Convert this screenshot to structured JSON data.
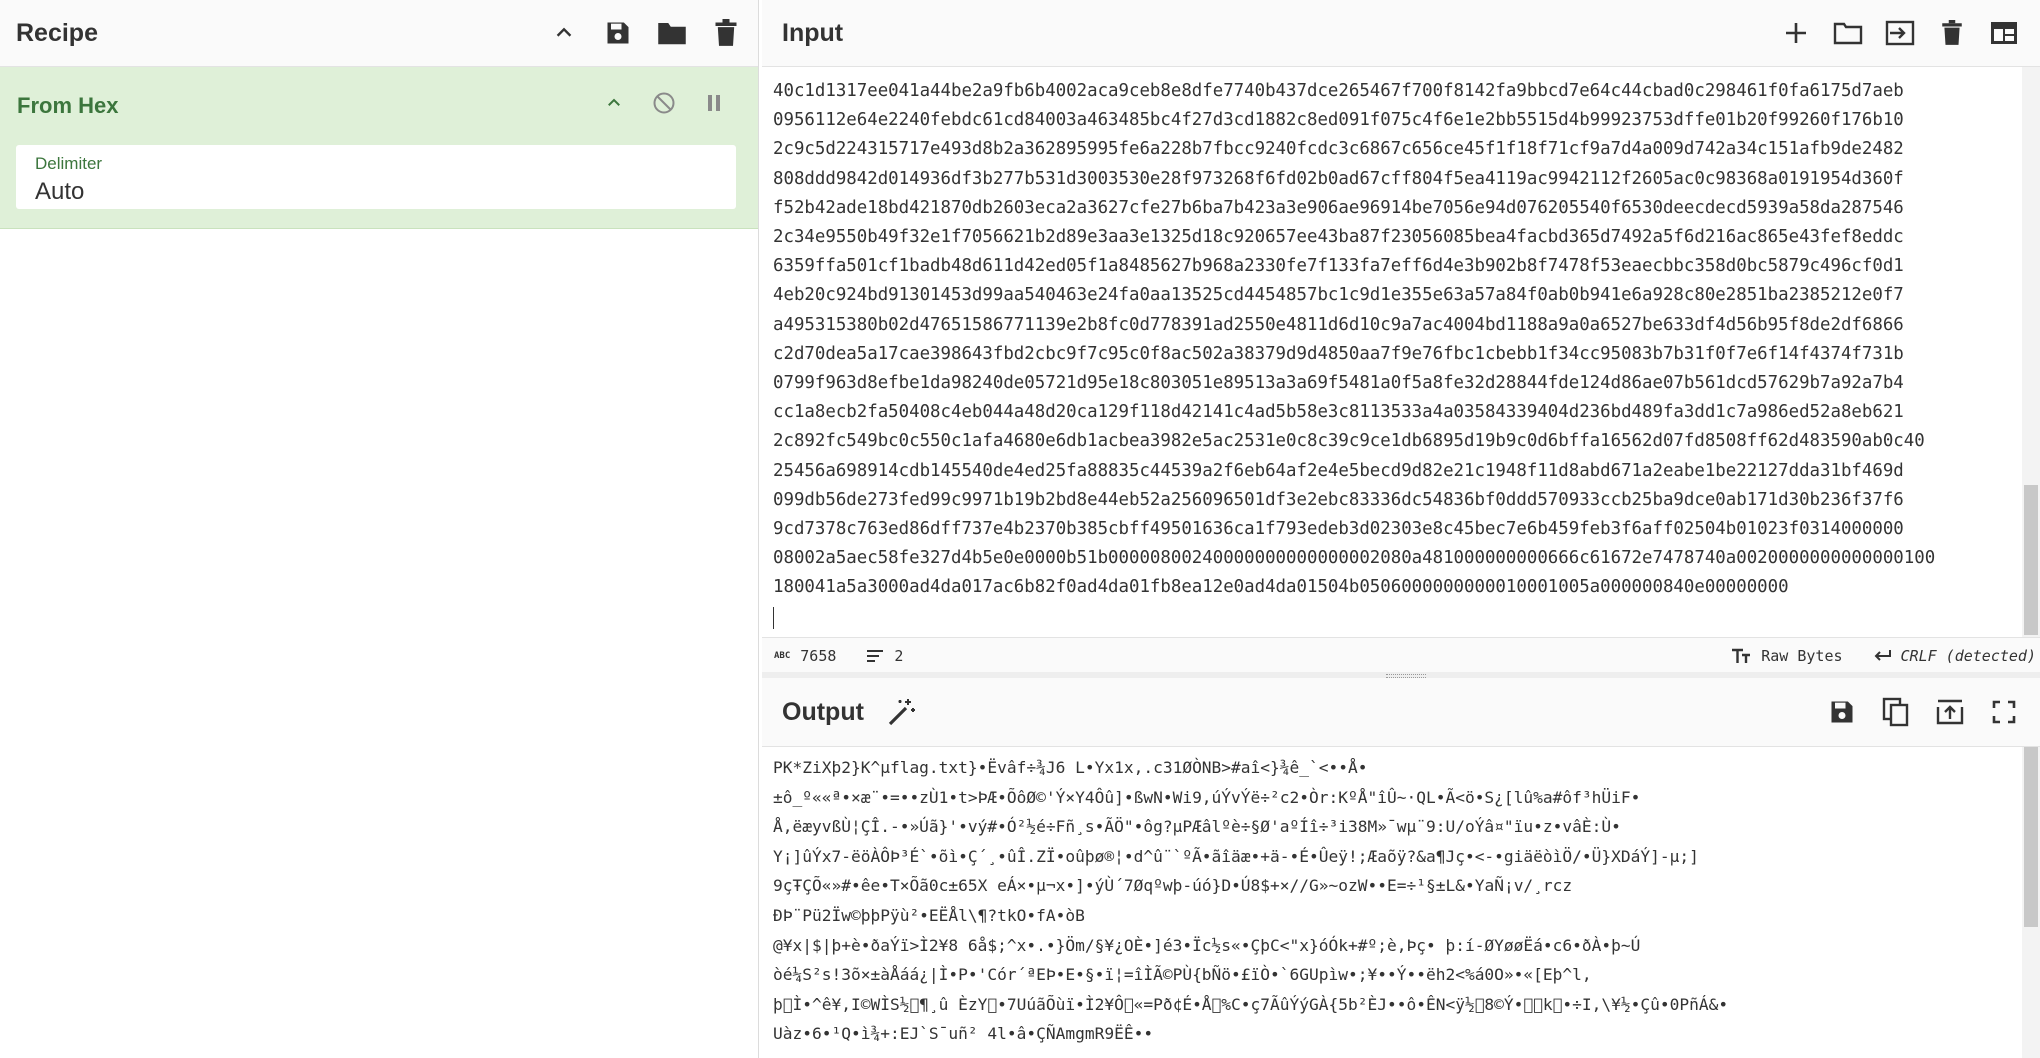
{
  "recipe": {
    "title": "Recipe",
    "operation": {
      "name": "From Hex",
      "arg_label": "Delimiter",
      "arg_value": "Auto"
    }
  },
  "input": {
    "title": "Input",
    "lines": [
      "40c1d1317ee041a44be2a9fb6b4002aca9ceb8e8dfe7740b437dce265467f700f8142fa9bbcd7e64c44cbad0c298461f0fa6175d7aeb",
      "0956112e64e2240febdc61cd84003a463485bc4f27d3cd1882c8ed091f075c4f6e1e2bb5515d4b99923753dffe01b20f99260f176b10",
      "2c9c5d224315717e493d8b2a362895995fe6a228b7fbcc9240fcdc3c6867c656ce45f1f18f71cf9a7d4a009d742a34c151afb9de2482",
      "808ddd9842d014936df3b277b531d3003530e28f973268f6fd02b0ad67cff804f5ea4119ac9942112f2605ac0c98368a0191954d360f",
      "f52b42ade18bd421870db2603eca2a3627cfe27b6ba7b423a3e906ae96914be7056e94d076205540f6530deecdecd5939a58da287546",
      "2c34e9550b49f32e1f7056621b2d89e3aa3e1325d18c920657ee43ba87f23056085bea4facbd365d7492a5f6d216ac865e43fef8eddc",
      "6359ffa501cf1badb48d611d42ed05f1a8485627b968a2330fe7f133fa7eff6d4e3b902b8f7478f53eaecbbc358d0bc5879c496cf0d1",
      "4eb20c924bd91301453d99aa540463e24fa0aa13525cd4454857bc1c9d1e355e63a57a84f0ab0b941e6a928c80e2851ba2385212e0f7",
      "a495315380b02d47651586771139e2b8fc0d778391ad2550e4811d6d10c9a7ac4004bd1188a9a0a6527be633df4d56b95f8de2df6866",
      "c2d70dea5a17cae398643fbd2cbc9f7c95c0f8ac502a38379d9d4850aa7f9e76fbc1cbebb1f34cc95083b7b31f0f7e6f14f4374f731b",
      "0799f963d8efbe1da98240de05721d95e18c803051e89513a3a69f5481a0f5a8fe32d28844fde124d86ae07b561dcd57629b7a92a7b4",
      "cc1a8ecb2fa50408c4eb044a48d20ca129f118d42141c4ad5b58e3c8113533a4a03584339404d236bd489fa3dd1c7a986ed52a8eb621",
      "2c892fc549bc0c550c1afa4680e6db1acbea3982e5ac2531e0c8c39c9ce1db6895d19b9c0d6bffa16562d07fd8508ff62d483590ab0c40",
      "25456a698914cdb145540de4ed25fa88835c44539a2f6eb64af2e4e5becd9d82e21c1948f11d8abd671a2eabe1be22127dda31bf469d",
      "099db56de273fed99c9971b19b2bd8e44eb52a256096501df3e2ebc83336dc54836bf0ddd570933ccb25ba9dce0ab171d30b236f37f6",
      "9cd7378c763ed86dff737e4b2370b385cbff49501636ca1f793edeb3d02303e8c45bec7e6b459feb3f6aff02504b01023f0314000000",
      "08002a5aec58fe327d4b5e0e0000b51b00000800240000000000000002080a481000000000666c61672e7478740a0020000000000000100",
      "180041a5a3000ad4da017ac6b82f0ad4da01fb8ea12e0ad4da01504b0506000000000010001005a000000840e00000000"
    ],
    "status": {
      "length_label": "ABC",
      "length": "7658",
      "lines": "2",
      "encoding": "Raw Bytes",
      "eol": "CRLF (detected)"
    }
  },
  "output": {
    "title": "Output",
    "lines": [
      "PK\u0003\u0004\u0014\u0000\u0000\u0000\b\u0000*ZiXþ2}K^\u000e\u0000\u0000µ\u001b\u0000\u0000\b\u0000\u0000\u0000flag.txt}•Ëvâf\u0010÷¾J6 L•Yx1x,.c31Ø\u0012ÒNB>\b#a\u0012î<}¾ê_`<••Å\u001c•",
      "±ô_º««ª•×æ¨•=••zÙ1•t>ÞÆ•ÕôØ©'Ý×Y4\u0019Ôû]•\u001bßwN•W\u0014i9,úÝvÝë÷²c2\u0019•Òr:KºÅ\"î\u0006Û~·QL•Ã<ö•S¿[lû%a#ôf³hÜiF•",
      "Å,ëæyvßÙ¦ÇÎ.-•»Úã}'•vý#\u0015•Ó²½é÷F\u0015ñ¸s•ÃÖ\"•ôg\u0011?µPÆâlºè÷\u0006§Ø'aºÍî÷³i38M»¯wµ¨9:U/\u0017oÝâ¤\u0017\"ïu•z•vâÈ:Ù\u0013\u000f•",
      "Y¡]ûÝx7-ëöÀÔ\u000bÞ³É`•õì•Ç´\u0019¸•ûÎ.Z\u000eÏ•oûþø®¦•d^û¨`ºÃ•ãîäæ•+ä-•É•Ûeÿ!;Æaõ\u000fÿ?&a¶Jç•<-•gi\u0018äëòìÖ/•Ü}XDáÝ]-µ;]\u0019",
      "9çŦÇÕ«»#•\u0017êe•T×\u001bÕã0c±6\u001b5X eÁ×•µ¬\fx•]•ýÙ´7Øqºwþ-úó}\u0015D•Ú8$+×//G»~ozW••E=\u001e÷¹§\u0005±L&•\u0013YaÑ¡v/¸rcz\u001d",
      "ÐÞ¨Pü2Ïw©þþPÿù²•EËÅl\\¶?\btk\u001bO•fA•\u0000òB\u001a\u001a",
      "@¥x|$|þ+è•ðaÝï>Ì2¥8 6\u0019\u0001å$;^x•.•}Öm/§¥¿OÈ•]é3\u001e•Ïc½s«•ÇþC<\"\u000bx}óÓk+#º;è,Þ\u0015ç•\u001e \u001cþ:í-ØYøøËá•c6•ðÀ•þ~Ú",
      "òé¼S\u0007²s!3õ\u001a\u0005×±àÅáá\u0012¿|Ì•P•\u0006'Cór´ªEÞ•E•§•ï¦=îÌÃ©PÙ{bÑö•£ïÒ•`6G\u0002Upìw•;¥••Ý\u0010\u0001•\u0007•ëh2<%á0O»•\u0016«[Eþ^l,\u0014\u0000",
      "þ\u0000Ì•^ê¥,I©WÌS½\u0010¶¸û ÈzY\u0011•7UúãÕùï•Ì2¥Ô\u0012«=Pð¢É•Å\u000e%C•ç7ÃûÝýGÀ{5b²ÈJ••ô•ÊN<ÿ½\u00148©Ý•\u001b\u001ck\u0013•÷I,\\¥½•Çû•0PñÁ&•",
      "Uà\u0017\u0004z•6•¹Q•ì¾+\u001c:EJ`S¯u\u0007ñ\b² 4l•â•ÇÑAmg\u001d\u0001mR9ËÊ••"
    ]
  },
  "colors": {
    "accent_green": "#3c763d",
    "operation_bg": "#dff0d8",
    "control_char_red": "#dd0000"
  },
  "icons": {
    "recipe_actions": [
      "chevron-up-icon",
      "save-icon",
      "folder-icon",
      "trash-icon"
    ],
    "input_actions": [
      "plus-icon",
      "folder-icon",
      "import-icon",
      "trash-icon",
      "layout-icon"
    ],
    "output_actions": [
      "save-icon",
      "copy-icon",
      "replace-input-icon",
      "fullscreen-icon"
    ]
  }
}
